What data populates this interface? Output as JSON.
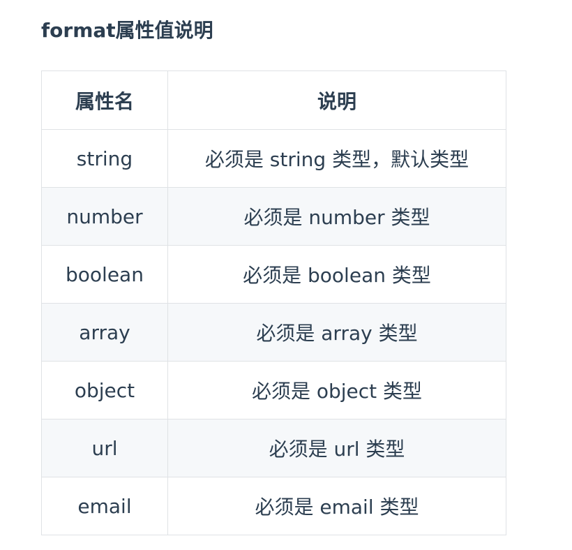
{
  "heading": "format属性值说明",
  "table": {
    "headers": [
      "属性名",
      "说明"
    ],
    "rows": [
      {
        "name": "string",
        "desc": "必须是 string 类型，默认类型"
      },
      {
        "name": "number",
        "desc": "必须是 number 类型"
      },
      {
        "name": "boolean",
        "desc": "必须是 boolean 类型"
      },
      {
        "name": "array",
        "desc": "必须是 array 类型"
      },
      {
        "name": "object",
        "desc": "必须是 object 类型"
      },
      {
        "name": "url",
        "desc": "必须是 url 类型"
      },
      {
        "name": "email",
        "desc": "必须是 email 类型"
      }
    ]
  },
  "colors": {
    "text": "#2c3e50",
    "border": "#dfe2e5",
    "stripe": "#f6f8fa"
  }
}
